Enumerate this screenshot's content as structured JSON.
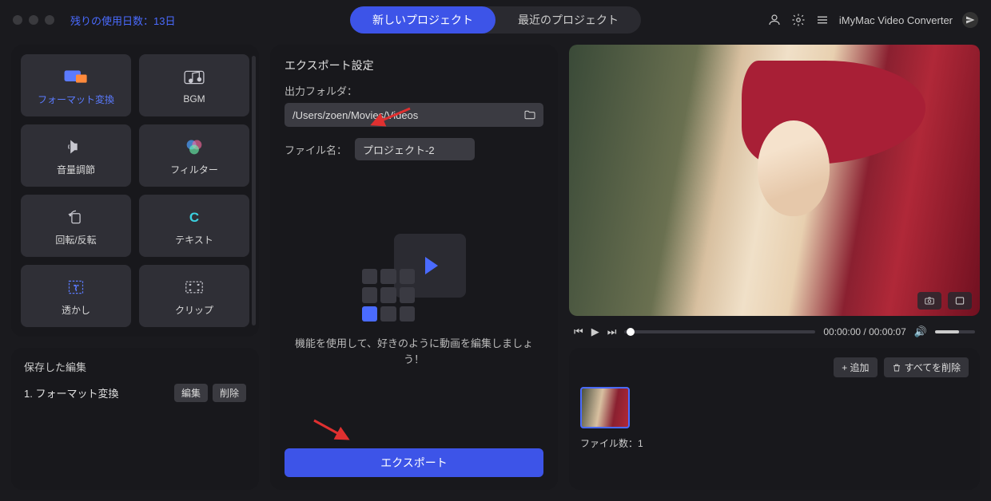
{
  "topbar": {
    "trial_label": "残りの使用日数：13日",
    "tab_new": "新しいプロジェクト",
    "tab_recent": "最近のプロジェクト",
    "app_name": "iMyMac Video Converter"
  },
  "sidebar": {
    "tools": [
      {
        "id": "format",
        "label": "フォーマット変換",
        "active": true
      },
      {
        "id": "bgm",
        "label": "BGM"
      },
      {
        "id": "volume",
        "label": "音量調節"
      },
      {
        "id": "filter",
        "label": "フィルター"
      },
      {
        "id": "rotate",
        "label": "回転/反転"
      },
      {
        "id": "text",
        "label": "テキスト"
      },
      {
        "id": "watermark",
        "label": "透かし"
      },
      {
        "id": "clip",
        "label": "クリップ"
      }
    ],
    "saved_header": "保存した編集",
    "saved_item": "1.  フォーマット変換",
    "edit_btn": "編集",
    "delete_btn": "削除"
  },
  "export": {
    "title": "エクスポート設定",
    "folder_label": "出力フォルダ：",
    "folder_path": "/Users/zoen/Movies/Videos",
    "filename_label": "ファイル名：",
    "filename_value": "プロジェクト-2",
    "hint": "機能を使用して、好きのように動画を編集しましょう！",
    "export_btn": "エクスポート"
  },
  "player": {
    "time": "00:00:00 / 00:00:07"
  },
  "clips": {
    "add_btn": "+ 追加",
    "delete_all_btn": "すべてを削除",
    "count_label": "ファイル数：1"
  }
}
